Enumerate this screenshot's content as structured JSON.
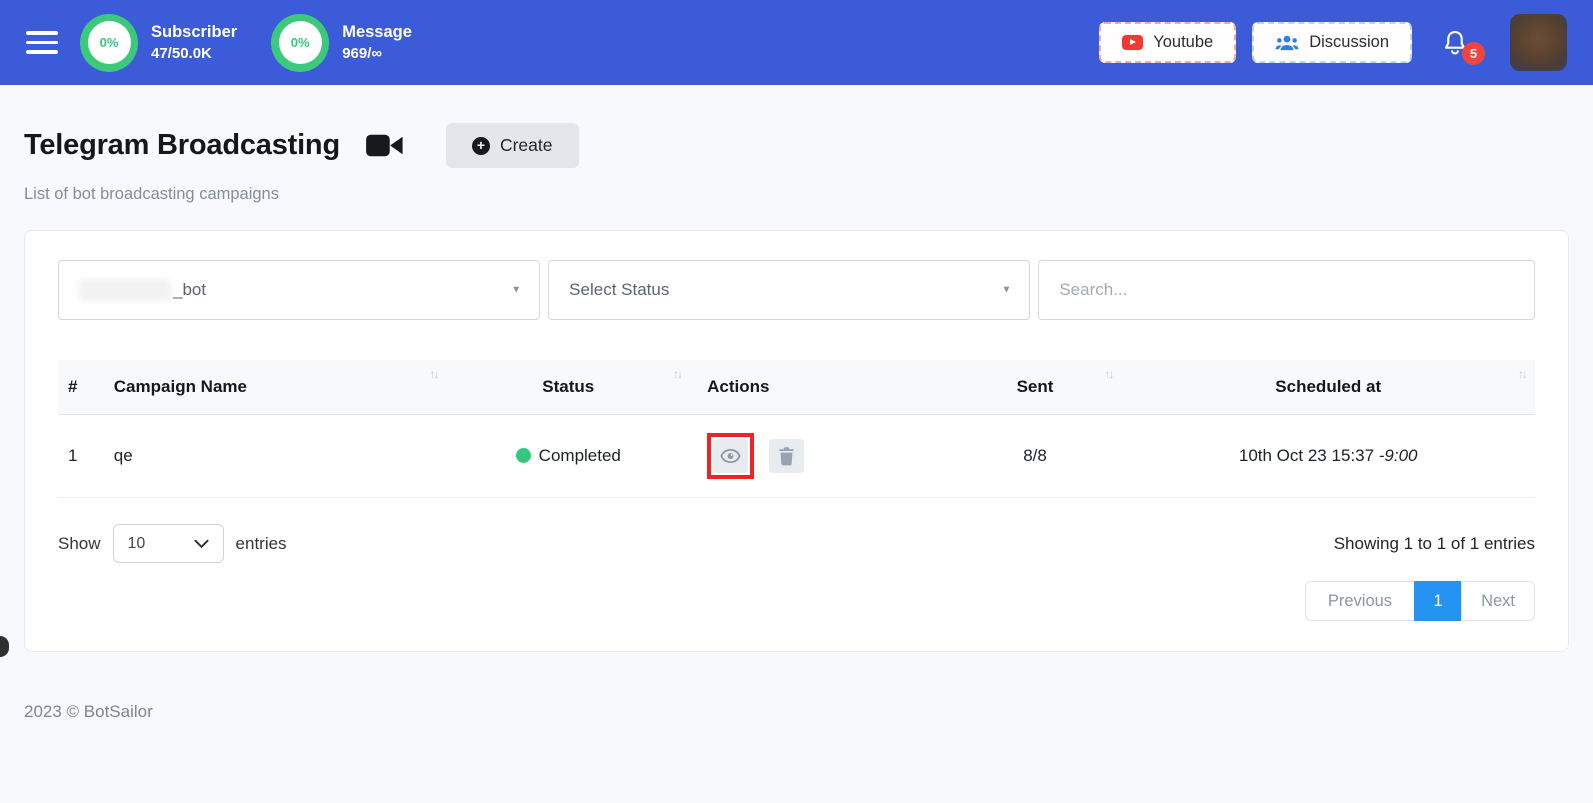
{
  "colors": {
    "header_blue": "#3b5bd8",
    "accent_green": "#3dc97c",
    "badge_red": "#f0453e",
    "pagination_blue": "#2493f2",
    "annotation_red": "#ee2424"
  },
  "header": {
    "stats": [
      {
        "percent": "0%",
        "label": "Subscriber",
        "value": "47/50.0K"
      },
      {
        "percent": "0%",
        "label": "Message",
        "value": "969/∞"
      }
    ],
    "youtube_label": "Youtube",
    "discussion_label": "Discussion",
    "notification_count": "5"
  },
  "page": {
    "title": "Telegram Broadcasting",
    "create_label": "Create",
    "subtitle": "List of bot broadcasting campaigns"
  },
  "filters": {
    "bot_select_value": "_bot",
    "status_select_value": "Select Status",
    "search_placeholder": "Search..."
  },
  "table": {
    "columns": [
      "#",
      "Campaign Name",
      "Status",
      "Actions",
      "Sent",
      "Scheduled at"
    ],
    "rows": [
      {
        "index": "1",
        "campaign_name": "qe",
        "status": "Completed",
        "sent": "8/8",
        "scheduled_at": "10th Oct 23 15:37",
        "timezone_offset": "-9:00"
      }
    ]
  },
  "table_controls": {
    "show_label": "Show",
    "page_size": "10",
    "entries_label": "entries",
    "showing_text": "Showing 1 to 1 of 1 entries"
  },
  "pagination": {
    "previous_label": "Previous",
    "current_page": "1",
    "next_label": "Next"
  },
  "footer": {
    "copyright": "2023 © BotSailor"
  },
  "icons": {
    "sort": "↑↓",
    "caret": "▼"
  }
}
